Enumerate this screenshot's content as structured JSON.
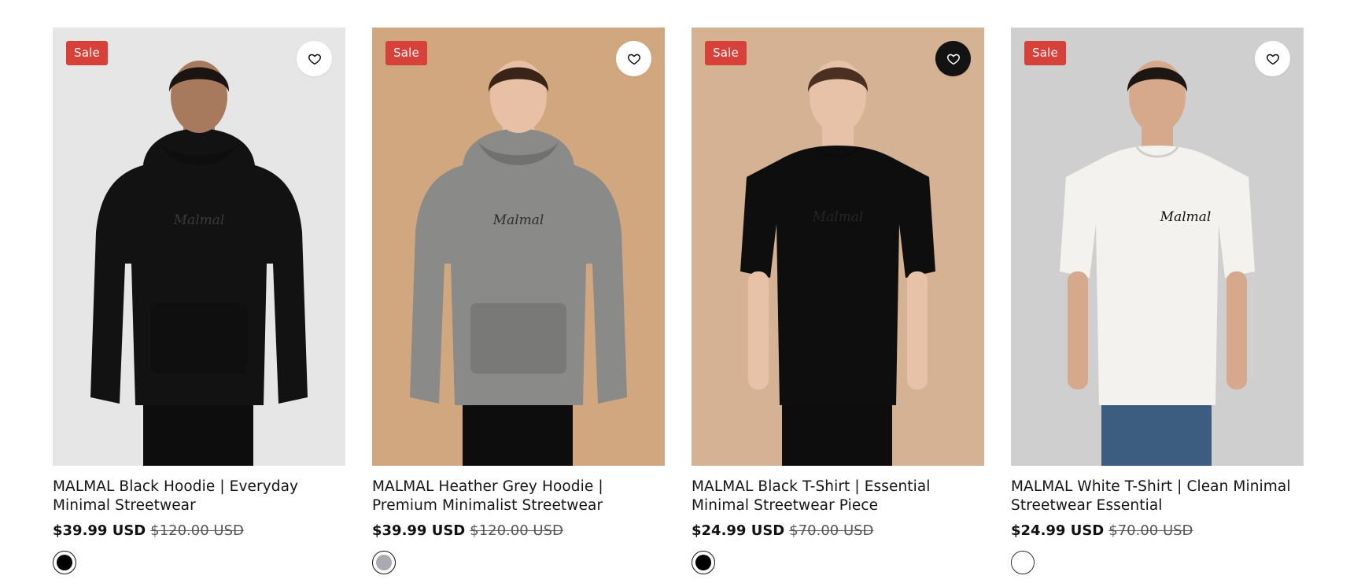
{
  "products": [
    {
      "badge": "Sale",
      "title": "MALMAL Black Hoodie | Everyday Minimal Streetwear",
      "price": "$39.99 USD",
      "compare_price": "$120.00 USD",
      "wishlisted": false,
      "image": {
        "background": "#e6e6e6",
        "garment": "hoodie",
        "garment_color": "#121212",
        "logo_text": "Malmal",
        "logo_color": "#3a3a3a",
        "skin": "#a77a5e",
        "hair": "#1b1410"
      },
      "swatch_color": "#000000"
    },
    {
      "badge": "Sale",
      "title": "MALMAL Heather Grey Hoodie | Premium Minimalist Streetwear",
      "price": "$39.99 USD",
      "compare_price": "$120.00 USD",
      "wishlisted": false,
      "image": {
        "background": "#d1a77f",
        "garment": "hoodie",
        "garment_color": "#8a8a88",
        "logo_text": "Malmal",
        "logo_color": "#2e2e2e",
        "skin": "#e7c0a6",
        "hair": "#3a2418"
      },
      "swatch_color": "#a8acb2"
    },
    {
      "badge": "Sale",
      "title": "MALMAL Black T-Shirt | Essential Minimal Streetwear Piece",
      "price": "$24.99 USD",
      "compare_price": "$70.00 USD",
      "wishlisted": true,
      "image": {
        "background": "#d4b293",
        "garment": "tshirt",
        "garment_color": "#0e0e0e",
        "logo_text": "Malmal",
        "logo_color": "#262626",
        "skin": "#e7c2a8",
        "hair": "#4b2f20"
      },
      "swatch_color": "#000000"
    },
    {
      "badge": "Sale",
      "title": "MALMAL White T-Shirt | Clean Minimal Streetwear Essential",
      "price": "$24.99 USD",
      "compare_price": "$70.00 USD",
      "wishlisted": false,
      "image": {
        "background": "#cfcfcf",
        "garment": "tshirt",
        "garment_color": "#f3f2ee",
        "logo_text": "Malmal",
        "logo_color": "#111111",
        "skin": "#d7a98c",
        "hair": "#1e1612",
        "pants_color": "#3d5d80"
      },
      "swatch_color": "#ffffff"
    }
  ],
  "icons": {
    "wishlist": "heart-icon"
  },
  "colors": {
    "sale_badge": "#d6423a",
    "text": "#141414",
    "compare_price": "#555555"
  }
}
